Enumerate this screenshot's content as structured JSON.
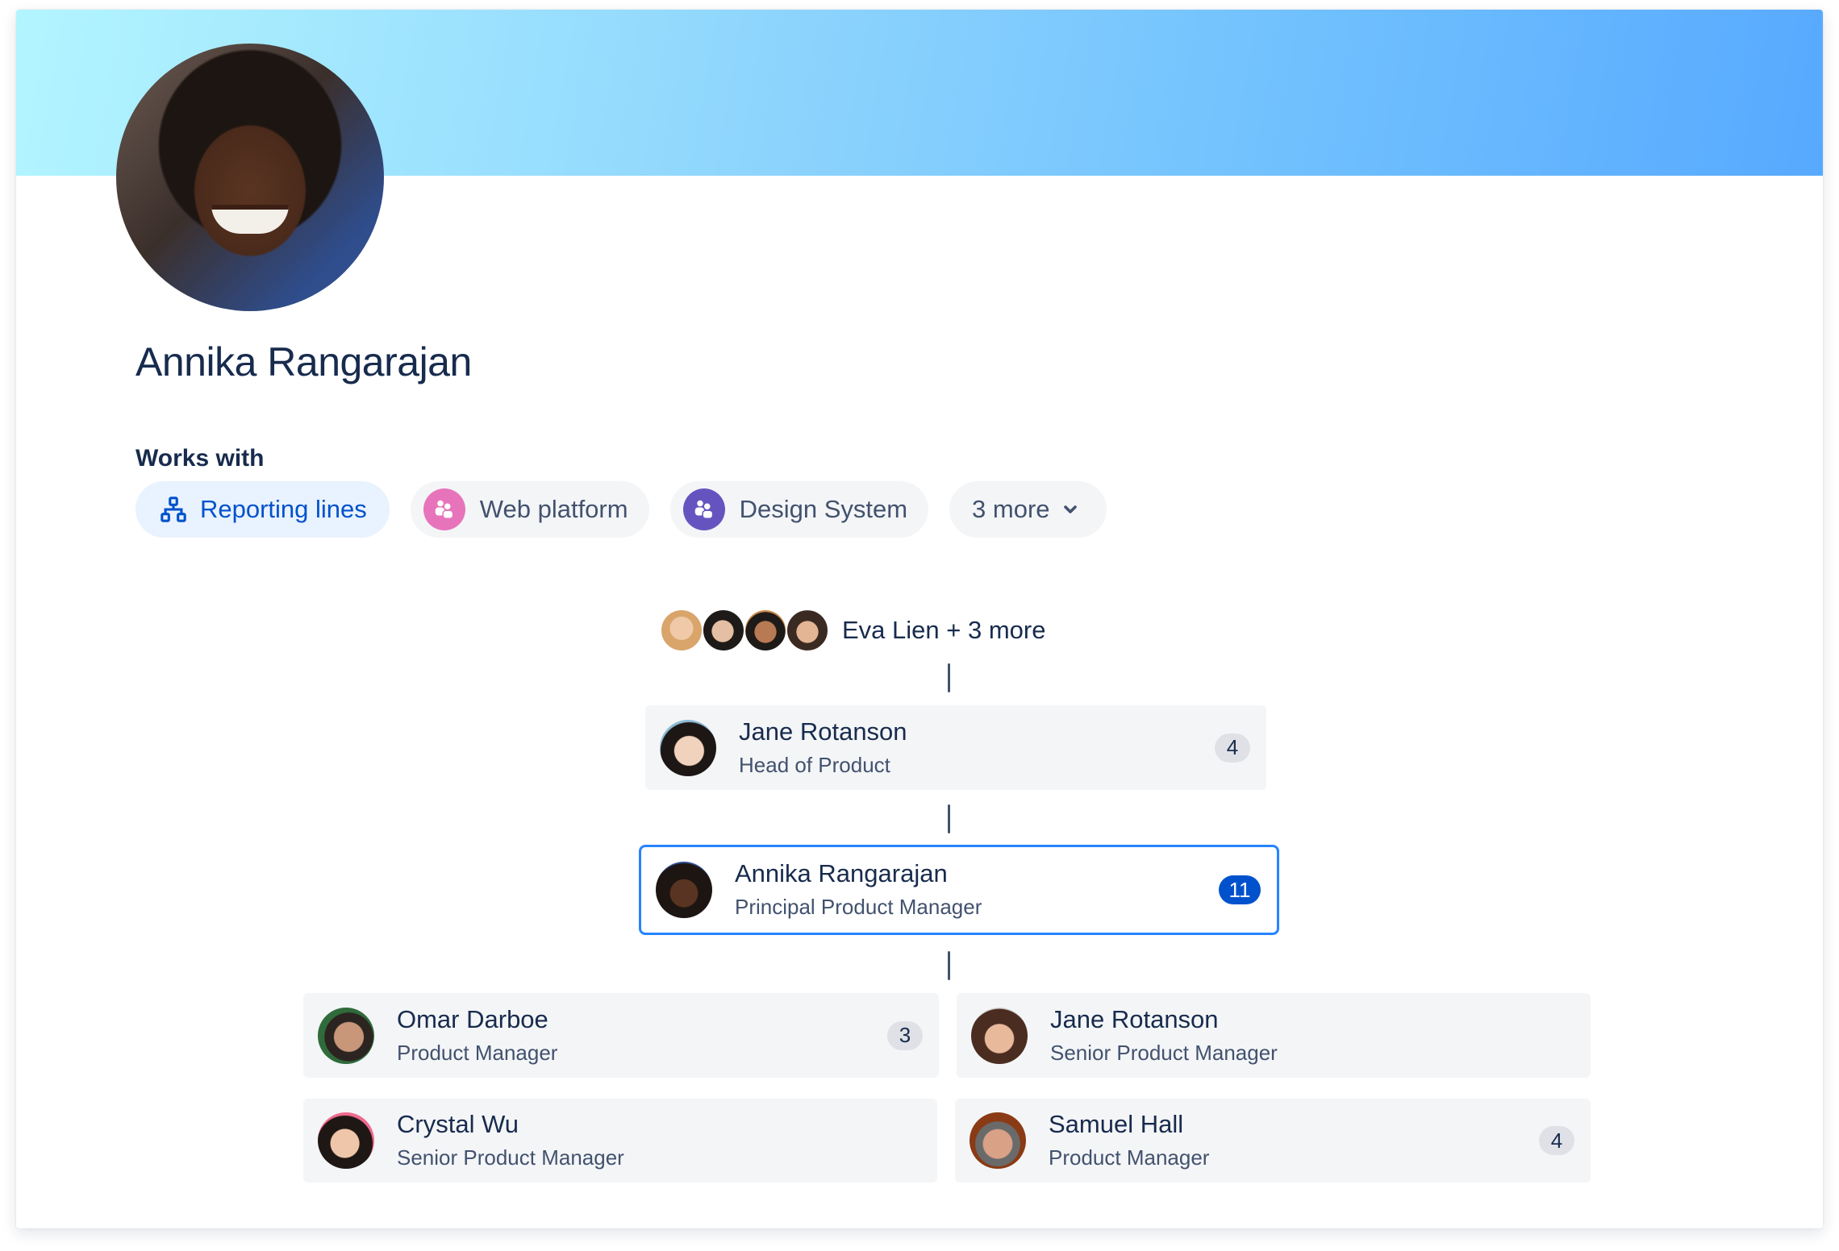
{
  "profile": {
    "name": "Annika Rangarajan",
    "avatar_icon": "person-photo"
  },
  "works_with": {
    "heading": "Works with",
    "chips": [
      {
        "label": "Reporting lines",
        "icon": "org-chart-icon",
        "active": true
      },
      {
        "label": "Web platform",
        "icon": "team-icon",
        "icon_color": "#e774bb"
      },
      {
        "label": "Design System",
        "icon": "team-icon",
        "icon_color": "#6554c0"
      },
      {
        "label": "3 more",
        "icon": "chevron-down-icon"
      }
    ]
  },
  "org_chart": {
    "managers": {
      "label": "Eva Lien + 3 more",
      "avatar_count": 4
    },
    "manager": {
      "name": "Jane Rotanson",
      "title": "Head of Product",
      "count": "4"
    },
    "current": {
      "name": "Annika Rangarajan",
      "title": "Principal Product Manager",
      "count": "11"
    },
    "reports": [
      {
        "name": "Omar Darboe",
        "title": "Product Manager",
        "count": "3"
      },
      {
        "name": "Jane Rotanson",
        "title": "Senior Product Manager",
        "count": null
      },
      {
        "name": "Crystal Wu",
        "title": "Senior Product Manager",
        "count": null
      },
      {
        "name": "Samuel Hall",
        "title": "Product Manager",
        "count": "4"
      }
    ]
  },
  "colors": {
    "banner_start": "#b3f5ff",
    "banner_end": "#57a9ff",
    "accent": "#0052cc",
    "selected_border": "#2684ff",
    "text_primary": "#172b4d",
    "text_secondary": "#42526e"
  }
}
